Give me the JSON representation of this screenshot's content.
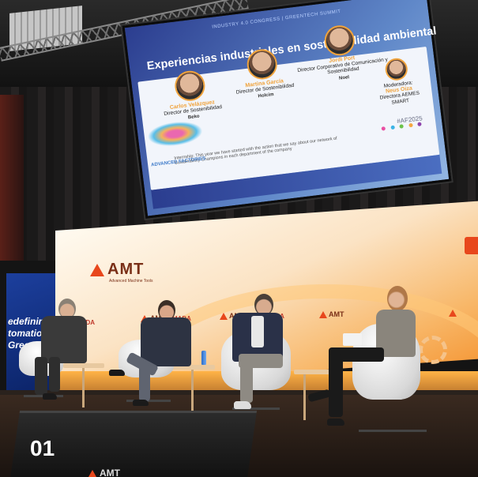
{
  "photo": {
    "number_label": "01",
    "slide": {
      "header": "INDUSTRY 4.0 CONGRESS | GREENTECH SUMMIT",
      "title": "Experiencias industriales en sostenibilidad ambiental",
      "speakers": [
        {
          "name": "Carlos Velázquez",
          "role": "Director de Sostenibilidad",
          "org": "Beko"
        },
        {
          "name": "Martina García",
          "role": "Director de Sostenibilidad",
          "org": "Holcim"
        },
        {
          "name": "Jordi Port",
          "role": "Director Corporativo de Comunicación y Sostenibilidad",
          "org": "Noel"
        }
      ],
      "moderator": {
        "label": "Moderadora:",
        "name": "Neus Oiza",
        "role": "Directora AEMES SMART"
      },
      "hashtag": "#AF2025",
      "caption": "Internship: This year we have started with the action that we say about our network of Sustainability Champions in each department of the company",
      "logo": "ADVANCED FACTORIES"
    },
    "banner": {
      "brand": "AMT",
      "brand_sub": "Advanced Machine Tools",
      "partner": "MADA"
    },
    "side_screen_lines": [
      "edefining",
      "tomation",
      "Green T"
    ],
    "monitor_brand": "AMT",
    "colors": {
      "amt_red": "#e8471c",
      "slide_blue": "#2b3d8f",
      "speaker_name_orange": "#f0a33c",
      "stage_glow": "#ffb347"
    }
  }
}
